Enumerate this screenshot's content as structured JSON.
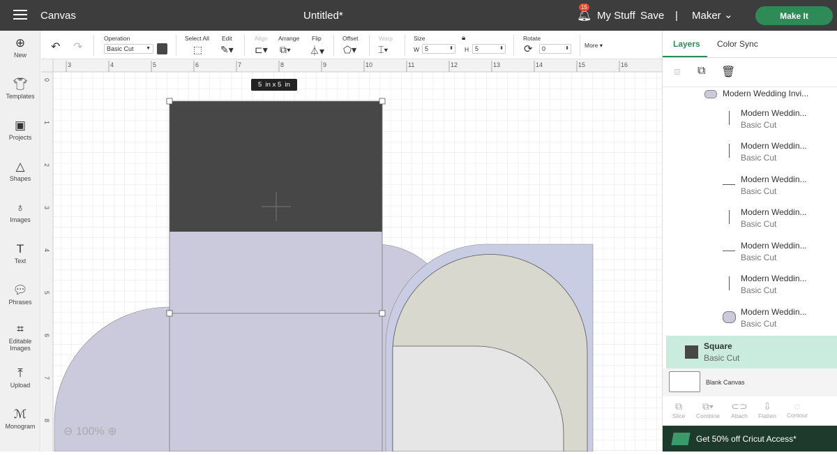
{
  "header": {
    "menu_icon": "hamburger-icon",
    "app": "Canvas",
    "title": "Untitled*",
    "notifications": "15",
    "my_stuff": "My Stuff",
    "save": "Save",
    "sep": "|",
    "machine": "Maker",
    "make_it": "Make It"
  },
  "sidebar": [
    {
      "label": "New",
      "icon": "plus-circle-icon"
    },
    {
      "label": "Templates",
      "icon": "shirt-icon"
    },
    {
      "label": "Projects",
      "icon": "projects-icon"
    },
    {
      "label": "Shapes",
      "icon": "shapes-icon"
    },
    {
      "label": "Images",
      "icon": "bulb-icon"
    },
    {
      "label": "Text",
      "icon": "text-icon"
    },
    {
      "label": "Phrases",
      "icon": "speech-icon"
    },
    {
      "label": "Editable Images",
      "icon": "edit-image-icon"
    },
    {
      "label": "Upload",
      "icon": "upload-icon"
    },
    {
      "label": "Monogram",
      "icon": "monogram-icon"
    }
  ],
  "toolbar": {
    "operation_label": "Operation",
    "operation_value": "Basic Cut",
    "select_all": "Select All",
    "edit": "Edit",
    "align": "Align",
    "arrange": "Arrange",
    "flip": "Flip",
    "offset": "Offset",
    "warp": "Warp",
    "size": "Size",
    "w_label": "W",
    "w": "5",
    "h_label": "H",
    "h": "5",
    "rotate": "Rotate",
    "rotate_value": "0",
    "more": "More",
    "fill_color": "#474747"
  },
  "canvas": {
    "ruler_x": [
      "3",
      "4",
      "5",
      "6",
      "7",
      "8",
      "9",
      "10",
      "11",
      "12",
      "13",
      "14",
      "15",
      "16"
    ],
    "ruler_y": [
      "0",
      "1",
      "2",
      "3",
      "4",
      "5",
      "6",
      "7",
      "8"
    ],
    "size_tooltip": "5  in x 5  in",
    "zoom": "100%"
  },
  "layers": {
    "tab_layers": "Layers",
    "tab_color_sync": "Color Sync",
    "group": "Modern Wedding Invi...",
    "items": [
      {
        "name": "Modern Weddin...",
        "op": "Basic Cut"
      },
      {
        "name": "Modern Weddin...",
        "op": "Basic Cut"
      },
      {
        "name": "Modern Weddin...",
        "op": "Basic Cut"
      },
      {
        "name": "Modern Weddin...",
        "op": "Basic Cut"
      },
      {
        "name": "Modern Weddin...",
        "op": "Basic Cut"
      },
      {
        "name": "Modern Weddin...",
        "op": "Basic Cut"
      },
      {
        "name": "Modern Weddin...",
        "op": "Basic Cut"
      }
    ],
    "selected": {
      "name": "Square",
      "op": "Basic Cut"
    },
    "blank": "Blank Canvas",
    "actions": [
      "Slice",
      "Combine",
      "Attach",
      "Flatten",
      "Contour"
    ],
    "promo": "Get 50% off Cricut Access*"
  },
  "colors": {
    "accent": "#2e8b57",
    "selected_bg": "#c9ecdf",
    "lavender": "#cbc9dc",
    "blue": "#c8cde4",
    "beige": "#d8d8cf"
  }
}
